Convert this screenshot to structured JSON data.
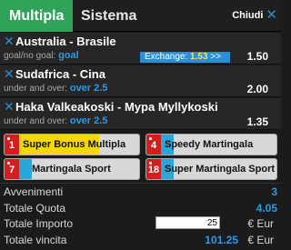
{
  "tabs": {
    "multipla": "Multipla",
    "sistema": "Sistema",
    "close": "Chiudi"
  },
  "bets": [
    {
      "event": "Australia - Brasile",
      "market": "goal/no goal:",
      "pick": "goal",
      "odd": "1.50",
      "exchange": {
        "label": "Exchange:",
        "value": "1.53",
        "arrow": ">>"
      }
    },
    {
      "event": "Sudafrica - Cina",
      "market": "under and over:",
      "pick": "over 2.5",
      "odd": "2.00"
    },
    {
      "event": "Haka Valkeakoski - Mypa Myllykoski",
      "market": "under and over:",
      "pick": "over 2.5",
      "odd": "1.35"
    }
  ],
  "bonuses": [
    {
      "num": "1",
      "label": "Super Bonus Multipla",
      "color": "#f6d800"
    },
    {
      "num": "4",
      "label": "Speedy Martingala",
      "color": "#2aa7d8"
    },
    {
      "num": "7",
      "label": "Martingala Sport",
      "color": "#2aa7d8"
    },
    {
      "num": "18",
      "label": "Super Martingala Sport",
      "color": "#2aa7d8"
    }
  ],
  "summary": {
    "avvenimenti_label": "Avvenimenti",
    "avvenimenti": "3",
    "quota_label": "Totale Quota",
    "quota": "4.05",
    "importo_label": "Totale Importo",
    "importo": "25",
    "importo_unit": "€ Eur",
    "vincita_label": "Totale vincita",
    "vincita": "101.25",
    "vincita_unit": "€ Eur"
  },
  "colors": {
    "tab_active": "#2fa35a",
    "accent_blue": "#2a9be6",
    "exchange_bg": "#2a8fd6",
    "exchange_value": "#ffe34a",
    "badge_red": "#d11f1f"
  }
}
